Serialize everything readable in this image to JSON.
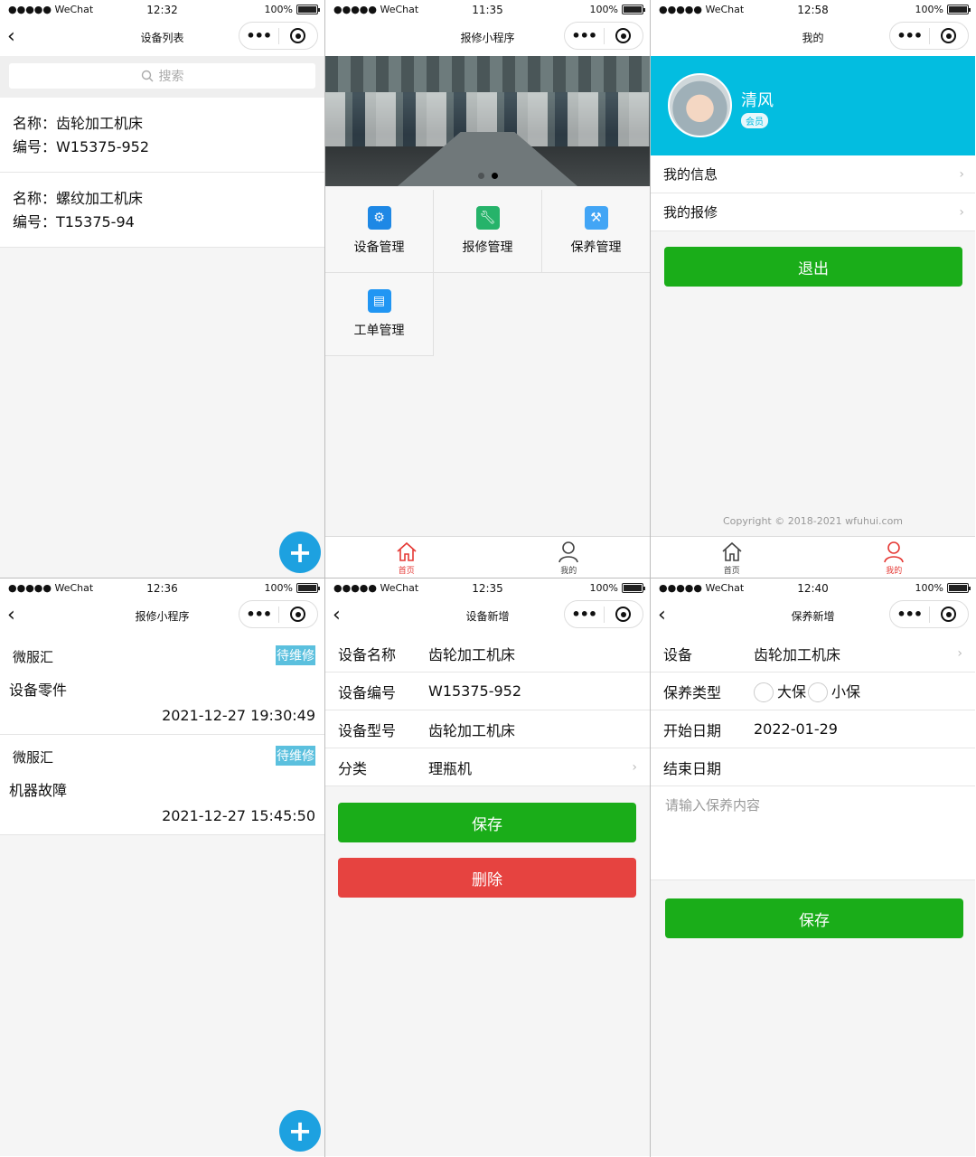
{
  "status": {
    "carrier": "●●●●● WeChat",
    "battery": "100%"
  },
  "capsule": {
    "more": "•••"
  },
  "screens": {
    "device_list": {
      "time": "12:32",
      "title": "设备列表",
      "search_placeholder": "搜索",
      "items": [
        {
          "name": "名称：齿轮加工机床",
          "code": "编号：W15375-952"
        },
        {
          "name": "名称：螺纹加工机床",
          "code": "编号：T15375-94"
        }
      ],
      "fab": "+"
    },
    "home": {
      "time": "11:35",
      "title": "报修小程序",
      "menu": [
        {
          "label": "设备管理",
          "icon": "gear-icon",
          "color": "#1e88e5"
        },
        {
          "label": "报修管理",
          "icon": "wrench-icon",
          "color": "#26b36a"
        },
        {
          "label": "保养管理",
          "icon": "maintenance-icon",
          "color": "#42a5f5"
        },
        {
          "label": "工单管理",
          "icon": "document-icon",
          "color": "#2196f3"
        }
      ],
      "tabs": {
        "home": "首页",
        "mine": "我的"
      }
    },
    "mine": {
      "time": "12:58",
      "title": "我的",
      "username": "清风",
      "badge": "会员",
      "rows": [
        "我的信息",
        "我的报修"
      ],
      "logout": "退出",
      "copyright": "Copyright © 2018-2021 wfuhui.com",
      "tabs": {
        "home": "首页",
        "mine": "我的"
      }
    },
    "repairs": {
      "time": "12:36",
      "title": "报修小程序",
      "orders": [
        {
          "from": "微服汇",
          "status": "待维修",
          "desc": "设备零件",
          "time": "2021-12-27 19:30:49"
        },
        {
          "from": "微服汇",
          "status": "待维修",
          "desc": "机器故障",
          "time": "2021-12-27 15:45:50"
        }
      ],
      "fab": "+"
    },
    "device_add": {
      "time": "12:35",
      "title": "设备新增",
      "fields": {
        "name": {
          "label": "设备名称",
          "value": "齿轮加工机床"
        },
        "code": {
          "label": "设备编号",
          "value": "W15375-952"
        },
        "model": {
          "label": "设备型号",
          "value": "齿轮加工机床"
        },
        "category": {
          "label": "分类",
          "value": "理瓶机"
        }
      },
      "save": "保存",
      "delete": "删除"
    },
    "maint_add": {
      "time": "12:40",
      "title": "保养新增",
      "device": {
        "label": "设备",
        "value": "齿轮加工机床"
      },
      "type": {
        "label": "保养类型",
        "option_big": "大保",
        "option_small": "小保"
      },
      "start": {
        "label": "开始日期",
        "value": "2022-01-29"
      },
      "end": {
        "label": "结束日期",
        "value": ""
      },
      "content_placeholder": "请输入保养内容",
      "save": "保存"
    }
  },
  "colors": {
    "accent_green": "#1aad19",
    "danger_red": "#e64340",
    "profile_blue": "#03bde0",
    "fab_blue": "#1da1e0",
    "status_blue": "#5bc0de",
    "tab_active": "#e53935"
  }
}
